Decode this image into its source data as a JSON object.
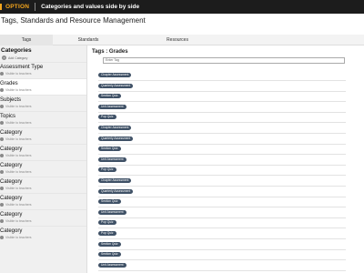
{
  "topbar": {
    "brand": "OPTION",
    "title": "Categories and values side by side"
  },
  "page_title": "Tags, Standards and Resource Management",
  "tabs": [
    {
      "label": "Tags"
    },
    {
      "label": "Standards"
    },
    {
      "label": "Resources"
    }
  ],
  "sidebar": {
    "title": "Categories",
    "add_label": "Add Category",
    "items": [
      {
        "label": "Assessment Type",
        "sub": "Visible to teachers"
      },
      {
        "label": "Grades",
        "sub": "Visible to teachers"
      },
      {
        "label": "Subjects",
        "sub": "Visible to teachers"
      },
      {
        "label": "Topics",
        "sub": "Visible to teachers"
      },
      {
        "label": "Category",
        "sub": "Visible to teachers"
      },
      {
        "label": "Category",
        "sub": "Visible to teachers"
      },
      {
        "label": "Category",
        "sub": "Visible to teachers"
      },
      {
        "label": "Category",
        "sub": "Visible to teachers"
      },
      {
        "label": "Category",
        "sub": "Visible to teachers"
      },
      {
        "label": "Category",
        "sub": "Visible to teachers"
      },
      {
        "label": "Category",
        "sub": "Visible to teachers"
      }
    ]
  },
  "main": {
    "title": "Tags : Grades",
    "search_placeholder": "Enter Tag",
    "tags": [
      "Chapter Assessment",
      "Quarterly Assessment",
      "Section Quiz",
      "Unit Assessment",
      "Pop Quiz",
      "Chapter Assessment",
      "Quarterly Assessment",
      "Section Quiz",
      "Unit Assessment",
      "Pop Quiz",
      "Chapter Assessment",
      "Quarterly Assessment",
      "Section Quiz",
      "Unit Assessment",
      "Pop Quiz",
      "Pop Quiz",
      "Section Quiz",
      "Section Quiz",
      "Unit Assessment"
    ]
  },
  "colors": {
    "brand": "#f4a51d",
    "chip": "#3f5166",
    "topbar": "#1c1c1c"
  }
}
